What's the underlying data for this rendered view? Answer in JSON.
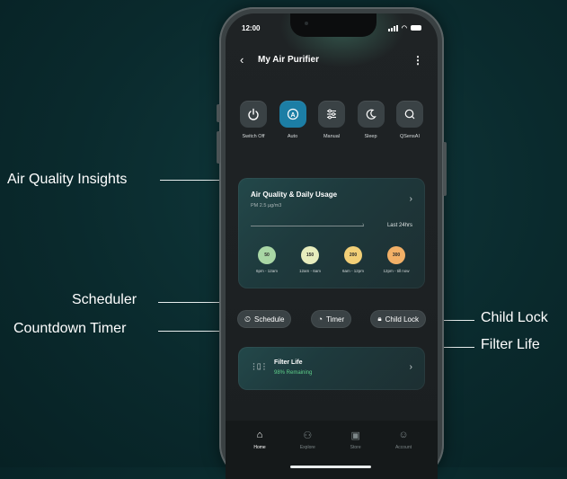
{
  "callouts": {
    "air_quality": "Air Quality Insights",
    "scheduler": "Scheduler",
    "countdown": "Countdown Timer",
    "child_lock": "Child Lock",
    "filter_life": "Filter Life"
  },
  "status": {
    "time": "12:00"
  },
  "header": {
    "title": "My Air Purifier"
  },
  "modes": [
    {
      "label": "Switch Off",
      "icon": "power-icon",
      "active": false
    },
    {
      "label": "Auto",
      "icon": "auto-icon",
      "active": true
    },
    {
      "label": "Manual",
      "icon": "sliders-icon",
      "active": false
    },
    {
      "label": "Sleep",
      "icon": "moon-icon",
      "active": false
    },
    {
      "label": "QSensAI",
      "icon": "qsensai-icon",
      "active": false
    }
  ],
  "air_card": {
    "title": "Air Quality & Daily Usage",
    "subtitle": "PM 2.5 µg/m3",
    "range": "Last 24hrs",
    "readings": [
      {
        "value": "50",
        "time": "6pm - 12am",
        "color": "#a9d7a5"
      },
      {
        "value": "150",
        "time": "12am - 6am",
        "color": "#e7edbd"
      },
      {
        "value": "200",
        "time": "6am - 12pm",
        "color": "#f2cf77"
      },
      {
        "value": "300",
        "time": "12pm - till now",
        "color": "#f2b067"
      }
    ]
  },
  "actions": {
    "schedule": "Schedule",
    "timer": "Timer",
    "child_lock": "Child Lock"
  },
  "filter": {
    "title": "Filter Life",
    "status": "98% Remaining"
  },
  "tabs": [
    {
      "label": "Home",
      "icon": "home-icon"
    },
    {
      "label": "Explore",
      "icon": "explore-icon"
    },
    {
      "label": "Store",
      "icon": "store-icon"
    },
    {
      "label": "Account",
      "icon": "account-icon"
    }
  ]
}
